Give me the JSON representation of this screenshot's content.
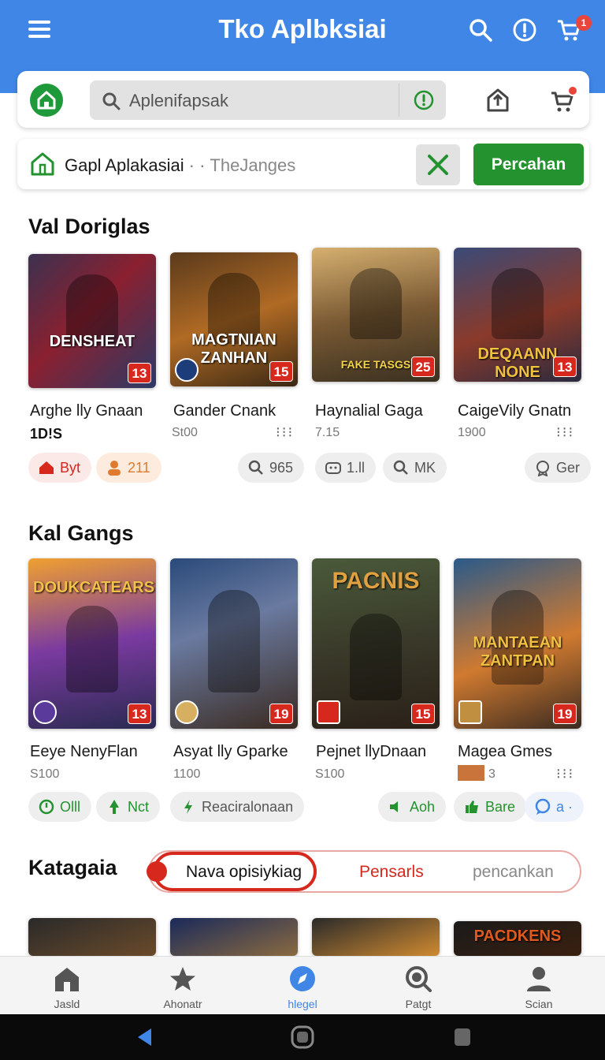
{
  "header": {
    "title": "Tko Aplbksiai",
    "cart_count": "1"
  },
  "search": {
    "placeholder": "Aplenifapsak"
  },
  "filter": {
    "label": "Gapl Aplakasiai",
    "sub": "TheJanges",
    "buy_label": "Percahan"
  },
  "sections": [
    {
      "title": "Val Doriglas",
      "games": [
        {
          "cover": "DENSHEAT",
          "rating": "13",
          "name": "Arghe lly Gnaan",
          "price": "1D!S"
        },
        {
          "cover": "MAGTNIAN ZANHAN",
          "rating": "15",
          "name": "Gander Cnank",
          "price": "St00"
        },
        {
          "cover": "FAKE TASGS",
          "rating": "25",
          "name": "Haynalial Gaga",
          "price": "7.15"
        },
        {
          "cover": "DEQAANN NONE",
          "rating": "13",
          "name": "CaigeVily Gnatn",
          "price": "1900"
        }
      ],
      "chips": [
        "Byt",
        "211",
        "965",
        "1.ll",
        "MK",
        "Ger"
      ]
    },
    {
      "title": "Kal Gangs",
      "games": [
        {
          "cover": "DOUKCATEARS",
          "rating": "13",
          "name": "Eeye NenyFlan",
          "price": "S100"
        },
        {
          "cover": "",
          "rating": "19",
          "name": "Asyat lly Gparke",
          "price": "1100"
        },
        {
          "cover": "PACNIS",
          "rating": "15",
          "name": "Pejnet llyDnaan",
          "price": "S100"
        },
        {
          "cover": "MANTAEAN ZANTPAN",
          "rating": "19",
          "name": "Magea Gmes",
          "price": "3"
        }
      ],
      "chips": [
        "Olll",
        "Nct",
        "Reaciralonaan",
        "Aoh",
        "Bare",
        "a ·"
      ]
    },
    {
      "title": "Katagaia",
      "tabs": [
        "Nava opisiykiag",
        "Pensarls",
        "pencankan"
      ],
      "covers": [
        "",
        "",
        "",
        "PACDKENS"
      ]
    }
  ],
  "bottom_nav": [
    "Jasld",
    "Ahonatr",
    "hlegel",
    "Patgt",
    "Scian"
  ],
  "colors": {
    "primary": "#3f86e6",
    "accent_green": "#23922f",
    "rating_red": "#d6281d"
  }
}
